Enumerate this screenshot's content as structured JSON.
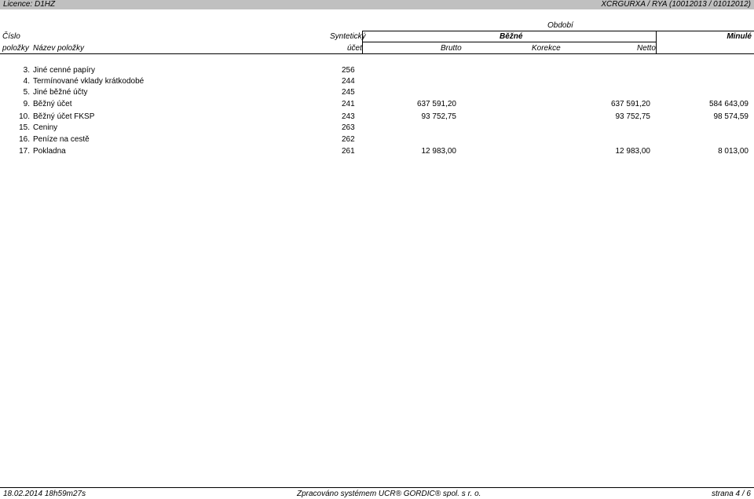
{
  "top": {
    "licence": "Licence: D1HZ",
    "report": "XCRGURXA / RYA  (10012013 / 01012012)"
  },
  "header": {
    "obdobi": "Období",
    "cislo": "Číslo",
    "polozky": "položky",
    "nazev": "Název položky",
    "synteticky": "Syntetický",
    "ucet": "účet",
    "bezne": "Běžné",
    "minule": "Minulé",
    "brutto": "Brutto",
    "korekce": "Korekce",
    "netto": "Netto"
  },
  "rows": [
    {
      "no": "3.",
      "name": "Jiné cenné papíry",
      "acct": "256",
      "brutto": "",
      "korekce": "",
      "netto": "",
      "minule": ""
    },
    {
      "no": "4.",
      "name": "Termínované vklady krátkodobé",
      "acct": "244",
      "brutto": "",
      "korekce": "",
      "netto": "",
      "minule": ""
    },
    {
      "no": "5.",
      "name": "Jiné běžné účty",
      "acct": "245",
      "brutto": "",
      "korekce": "",
      "netto": "",
      "minule": ""
    },
    {
      "no": "9.",
      "name": "Běžný účet",
      "acct": "241",
      "brutto": "637 591,20",
      "korekce": "",
      "netto": "637 591,20",
      "minule": "584 643,09"
    },
    {
      "no": "10.",
      "name": "Běžný účet FKSP",
      "acct": "243",
      "brutto": "93 752,75",
      "korekce": "",
      "netto": "93 752,75",
      "minule": "98 574,59"
    },
    {
      "no": "15.",
      "name": "Ceniny",
      "acct": "263",
      "brutto": "",
      "korekce": "",
      "netto": "",
      "minule": ""
    },
    {
      "no": "16.",
      "name": "Peníze na cestě",
      "acct": "262",
      "brutto": "",
      "korekce": "",
      "netto": "",
      "minule": ""
    },
    {
      "no": "17.",
      "name": "Pokladna",
      "acct": "261",
      "brutto": "12 983,00",
      "korekce": "",
      "netto": "12 983,00",
      "minule": "8 013,00"
    }
  ],
  "footer": {
    "datetime": "18.02.2014 18h59m27s",
    "system": "Zpracováno systémem  UCR® GORDIC® spol. s  r. o.",
    "page": "strana 4 / 6"
  }
}
